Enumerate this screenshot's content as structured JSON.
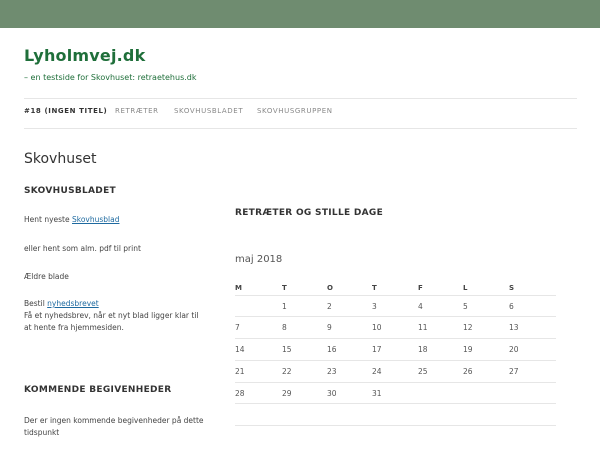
{
  "site": {
    "title": "Lyholmvej.dk",
    "description": "– en testside for Skovhuset: retraetehus.dk"
  },
  "nav": {
    "items": [
      {
        "label": "#18 (INGEN TITEL)",
        "current": true
      },
      {
        "label": "RETRÆTER",
        "current": false
      },
      {
        "label": "SKOVHUSBLADET",
        "current": false
      },
      {
        "label": "SKOVHUSGRUPPEN",
        "current": false
      }
    ]
  },
  "page": {
    "title": "Skovhuset"
  },
  "sidebar": {
    "widget1_title": "SKOVHUSBLADET",
    "hent_prefix": "Hent nyeste ",
    "hent_link": "Skovhusblad",
    "pdf_text": "eller hent som alm. pdf til print",
    "aeldre": "Ældre blade",
    "bestil_prefix": "Bestil ",
    "bestil_link": "nyhedsbrevet",
    "nyhed_text": "Få et nyhedsbrev, når et nyt blad ligger klar til at hente fra hjemmesiden.",
    "widget2_title": "KOMMENDE BEGIVENHEDER",
    "no_events": "Der er ingen kommende begivenheder på dette tidspunkt"
  },
  "calendar": {
    "title": "RETRÆTER OG STILLE DAGE",
    "caption": "maj 2018",
    "weekdays": [
      "M",
      "T",
      "O",
      "T",
      "F",
      "L",
      "S"
    ],
    "weeks": [
      [
        "",
        "1",
        "2",
        "3",
        "4",
        "5",
        "6"
      ],
      [
        "7",
        "8",
        "9",
        "10",
        "11",
        "12",
        "13"
      ],
      [
        "14",
        "15",
        "16",
        "17",
        "18",
        "19",
        "20"
      ],
      [
        "21",
        "22",
        "23",
        "24",
        "25",
        "26",
        "27"
      ],
      [
        "28",
        "29",
        "30",
        "31",
        "",
        "",
        ""
      ]
    ]
  },
  "colors": {
    "top_band": "#6f8c70",
    "title_green": "#1f6f3a",
    "link_blue": "#1e6aa0"
  }
}
